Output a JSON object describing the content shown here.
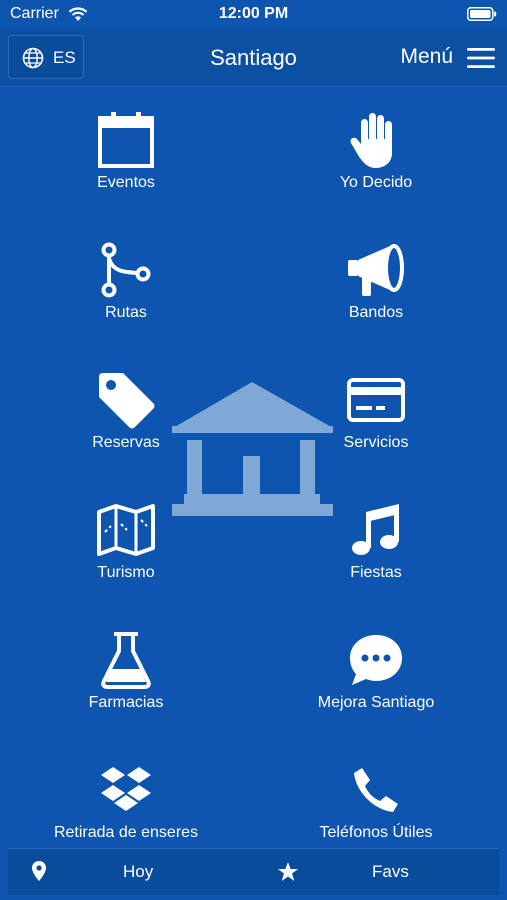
{
  "status": {
    "carrier": "Carrier",
    "time": "12:00 PM"
  },
  "header": {
    "lang_code": "ES",
    "title": "Santiago",
    "menu_label": "Menú"
  },
  "tiles": [
    {
      "label": "Eventos",
      "icon": "calendar-icon"
    },
    {
      "label": "Yo Decido",
      "icon": "hand-icon"
    },
    {
      "label": "Rutas",
      "icon": "route-icon"
    },
    {
      "label": "Bandos",
      "icon": "megaphone-icon"
    },
    {
      "label": "Reservas",
      "icon": "tag-icon"
    },
    {
      "label": "Servicios",
      "icon": "credit-card-icon"
    },
    {
      "label": "Turismo",
      "icon": "map-icon"
    },
    {
      "label": "Fiestas",
      "icon": "music-icon"
    },
    {
      "label": "Farmacias",
      "icon": "flask-icon"
    },
    {
      "label": "Mejora Santiago",
      "icon": "chat-bubble-icon"
    },
    {
      "label": "Retirada de enseres",
      "icon": "boxes-icon"
    },
    {
      "label": "Teléfonos Útiles",
      "icon": "phone-icon"
    }
  ],
  "tabbar": {
    "today_label": "Hoy",
    "favs_label": "Favs"
  },
  "colors": {
    "background": "#0D55AE",
    "navbar": "#0B50A3",
    "watermark": "#7FA8D6"
  }
}
